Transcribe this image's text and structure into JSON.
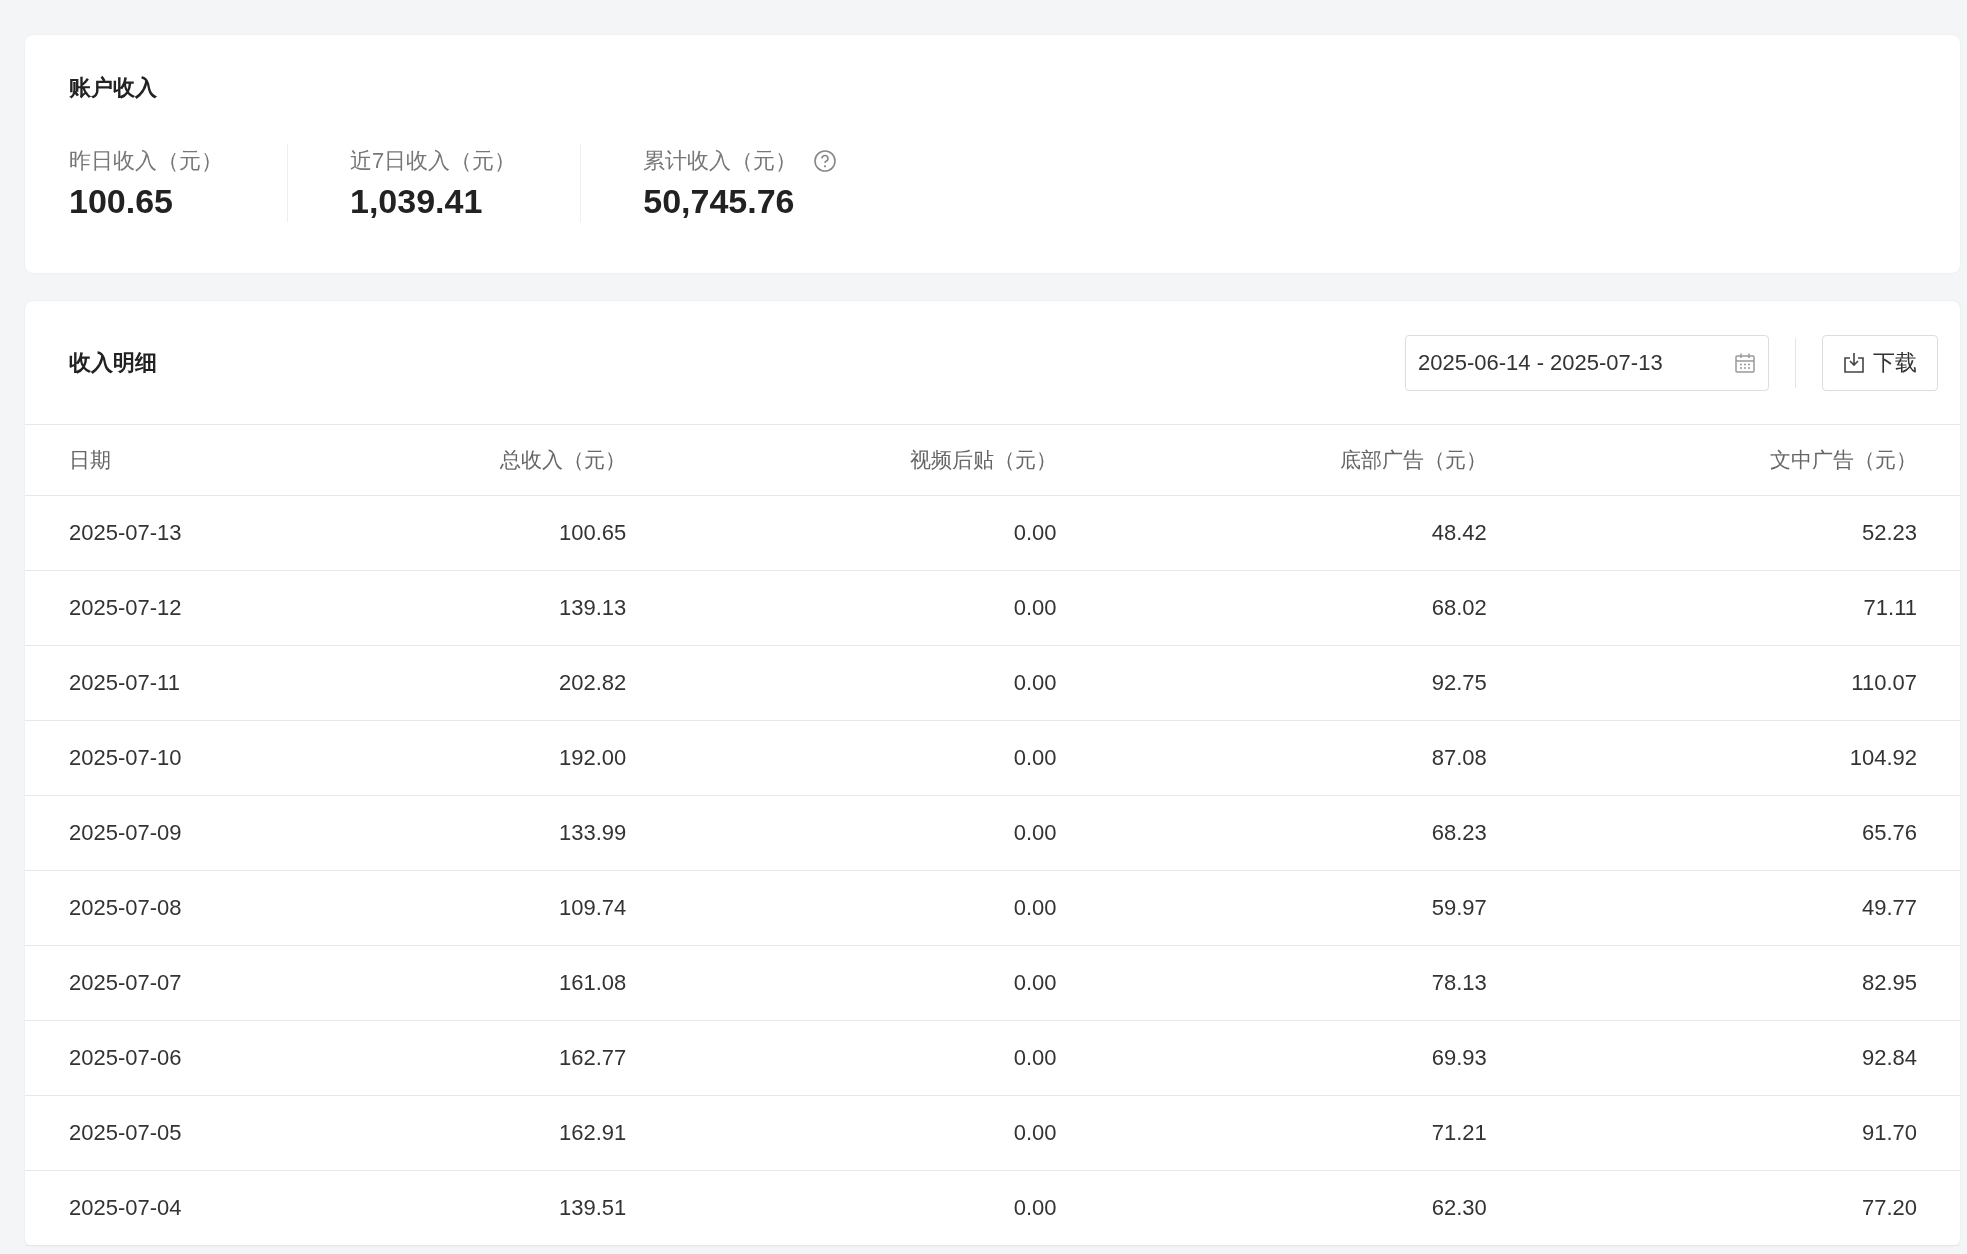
{
  "account_income": {
    "title": "账户收入",
    "stats": [
      {
        "label": "昨日收入（元）",
        "value": "100.65",
        "has_help": false
      },
      {
        "label": "近7日收入（元）",
        "value": "1,039.41",
        "has_help": false
      },
      {
        "label": "累计收入（元）",
        "value": "50,745.76",
        "has_help": true
      }
    ]
  },
  "income_detail": {
    "title": "收入明细",
    "date_range": {
      "value": "2025-06-14 - 2025-07-13"
    },
    "download_button": {
      "label": "下载"
    },
    "table": {
      "columns": [
        "日期",
        "总收入（元）",
        "视频后贴（元）",
        "底部广告（元）",
        "文中广告（元）"
      ],
      "rows": [
        [
          "2025-07-13",
          "100.65",
          "0.00",
          "48.42",
          "52.23"
        ],
        [
          "2025-07-12",
          "139.13",
          "0.00",
          "68.02",
          "71.11"
        ],
        [
          "2025-07-11",
          "202.82",
          "0.00",
          "92.75",
          "110.07"
        ],
        [
          "2025-07-10",
          "192.00",
          "0.00",
          "87.08",
          "104.92"
        ],
        [
          "2025-07-09",
          "133.99",
          "0.00",
          "68.23",
          "65.76"
        ],
        [
          "2025-07-08",
          "109.74",
          "0.00",
          "59.97",
          "49.77"
        ],
        [
          "2025-07-07",
          "161.08",
          "0.00",
          "78.13",
          "82.95"
        ],
        [
          "2025-07-06",
          "162.77",
          "0.00",
          "69.93",
          "92.84"
        ],
        [
          "2025-07-05",
          "162.91",
          "0.00",
          "71.21",
          "91.70"
        ],
        [
          "2025-07-04",
          "139.51",
          "0.00",
          "62.30",
          "77.20"
        ]
      ]
    }
  }
}
